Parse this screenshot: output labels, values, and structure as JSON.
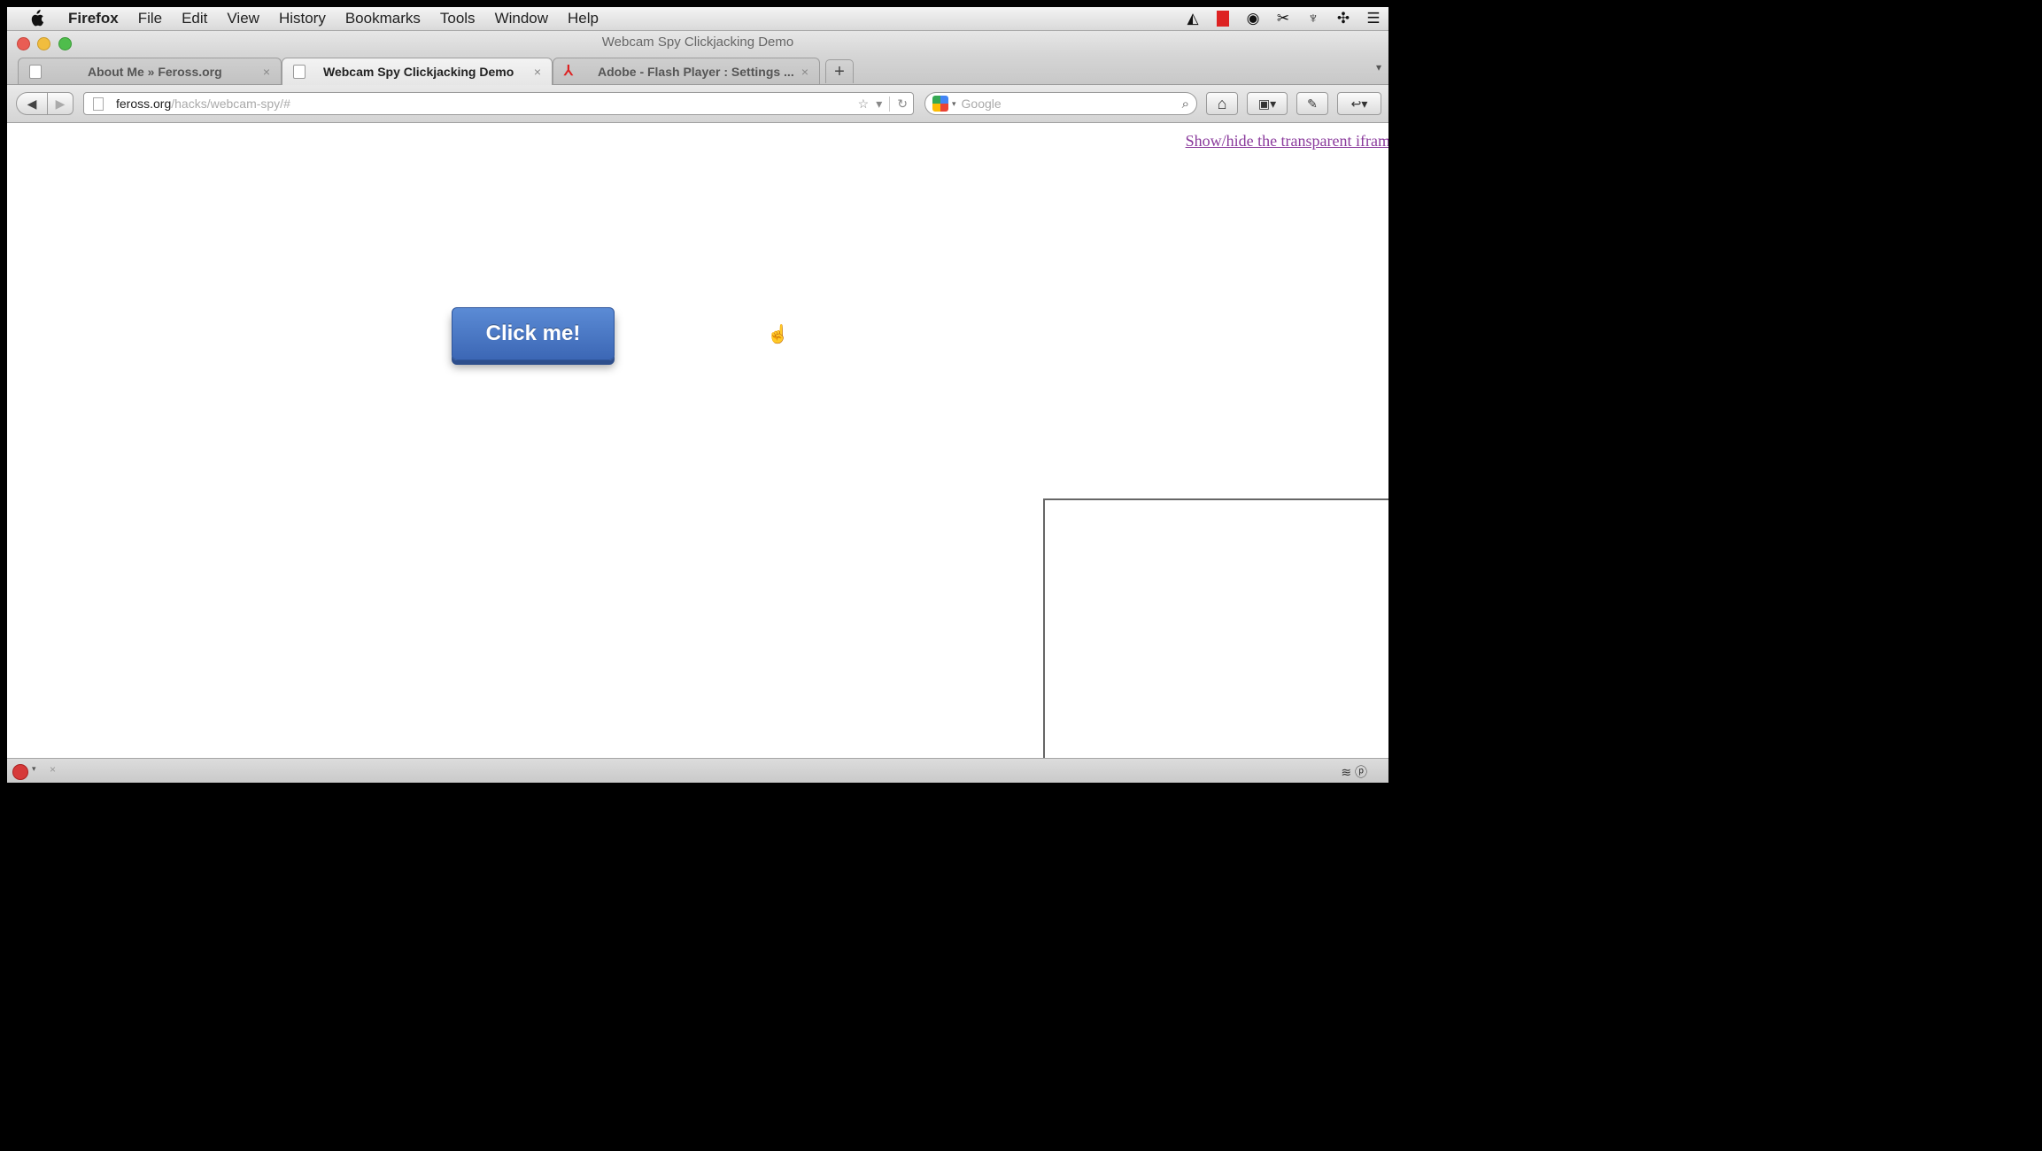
{
  "menubar": {
    "app": "Firefox",
    "items": [
      "File",
      "Edit",
      "View",
      "History",
      "Bookmarks",
      "Tools",
      "Window",
      "Help"
    ],
    "status_icons": [
      "triangle-icon",
      "red-square-icon",
      "webcam-icon",
      "tools-icon",
      "trophy-icon",
      "move-icon",
      "list-icon"
    ]
  },
  "window": {
    "title": "Webcam Spy Clickjacking Demo"
  },
  "tabs": [
    {
      "label": "About Me » Feross.org",
      "close": "×"
    },
    {
      "label": "Webcam Spy Clickjacking Demo",
      "close": "×"
    },
    {
      "label": "Adobe - Flash Player : Settings ...",
      "close": "×"
    }
  ],
  "new_tab": "+",
  "nav": {
    "back": "◀",
    "forward": "▶",
    "url_domain": "feross.org",
    "url_path": "/hacks/webcam-spy/#",
    "search_placeholder": "Google",
    "star": "☆",
    "dropdown": "▾",
    "reload": "↻",
    "magnifier": "⌕",
    "home": "⌂",
    "tool1": "▣▾",
    "tool2": "✎",
    "tool3": "↩▾"
  },
  "content": {
    "toggle_link": "Show/hide the transparent iframe",
    "click_button": "Click me!",
    "cursor": "☝"
  },
  "statusbar": {
    "addon_caret": "▾",
    "addon_close": "×",
    "right_icons": "≋ ⓟ"
  }
}
